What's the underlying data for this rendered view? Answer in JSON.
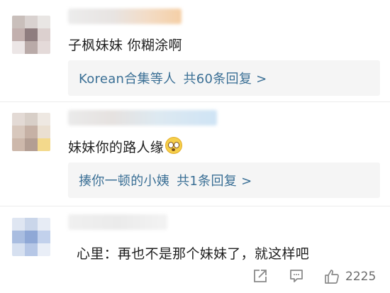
{
  "comments": [
    {
      "text": "子枫妹妹 你糊涂啊",
      "reply_link": "Korean合集等人",
      "reply_count": "共60条回复 >"
    },
    {
      "text": "妹妹你的路人缘",
      "reply_link": "揍你一顿的小姨",
      "reply_count": "共1条回复 >"
    },
    {
      "text": "心里：再也不是那个妹妹了，就这样吧"
    }
  ],
  "actions": {
    "like_count": "2225"
  },
  "colors": {
    "link": "#3a6f95",
    "reply_bg": "#f5f5f5",
    "text": "#1f1f1f",
    "icon": "#8a8a8a"
  },
  "icons": [
    "share-icon",
    "comment-icon",
    "like-icon",
    "emoji-icon"
  ]
}
